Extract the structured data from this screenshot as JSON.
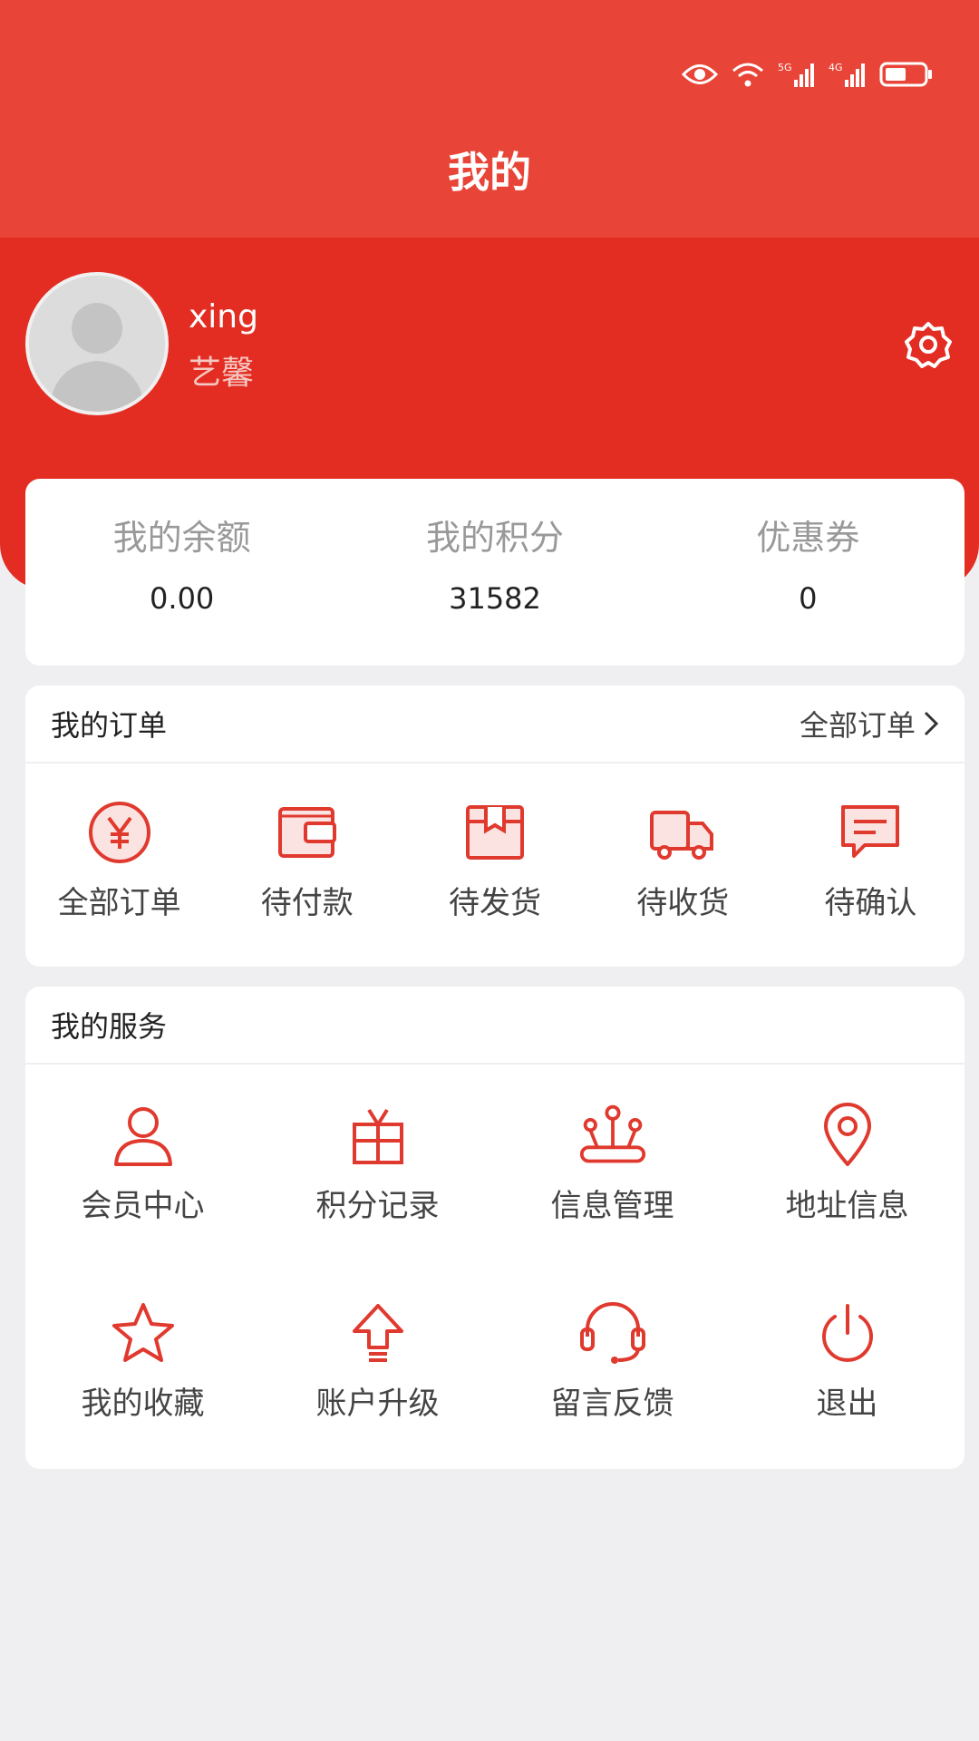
{
  "header": {
    "title": "我的"
  },
  "profile": {
    "name": "xing",
    "subtitle": "艺馨"
  },
  "wallet": [
    {
      "label": "我的余额",
      "value": "0.00"
    },
    {
      "label": "我的积分",
      "value": "31582"
    },
    {
      "label": "优惠券",
      "value": "0"
    }
  ],
  "orders": {
    "title": "我的订单",
    "link": "全部订单",
    "items": [
      {
        "label": "全部订单",
        "icon": "yen-circle-icon"
      },
      {
        "label": "待付款",
        "icon": "wallet-icon"
      },
      {
        "label": "待发货",
        "icon": "package-icon"
      },
      {
        "label": "待收货",
        "icon": "truck-icon"
      },
      {
        "label": "待确认",
        "icon": "message-icon"
      }
    ]
  },
  "services": {
    "title": "我的服务",
    "items": [
      {
        "label": "会员中心",
        "icon": "user-icon"
      },
      {
        "label": "积分记录",
        "icon": "gift-icon"
      },
      {
        "label": "信息管理",
        "icon": "info-manage-icon"
      },
      {
        "label": "地址信息",
        "icon": "location-pin-icon"
      },
      {
        "label": "我的收藏",
        "icon": "star-icon"
      },
      {
        "label": "账户升级",
        "icon": "upgrade-arrow-icon"
      },
      {
        "label": "留言反馈",
        "icon": "headset-icon"
      },
      {
        "label": "退出",
        "icon": "power-icon"
      }
    ]
  },
  "colors": {
    "header": "#e84438",
    "band": "#e32d22",
    "accent": "#e0392e",
    "background": "#efeff2"
  }
}
